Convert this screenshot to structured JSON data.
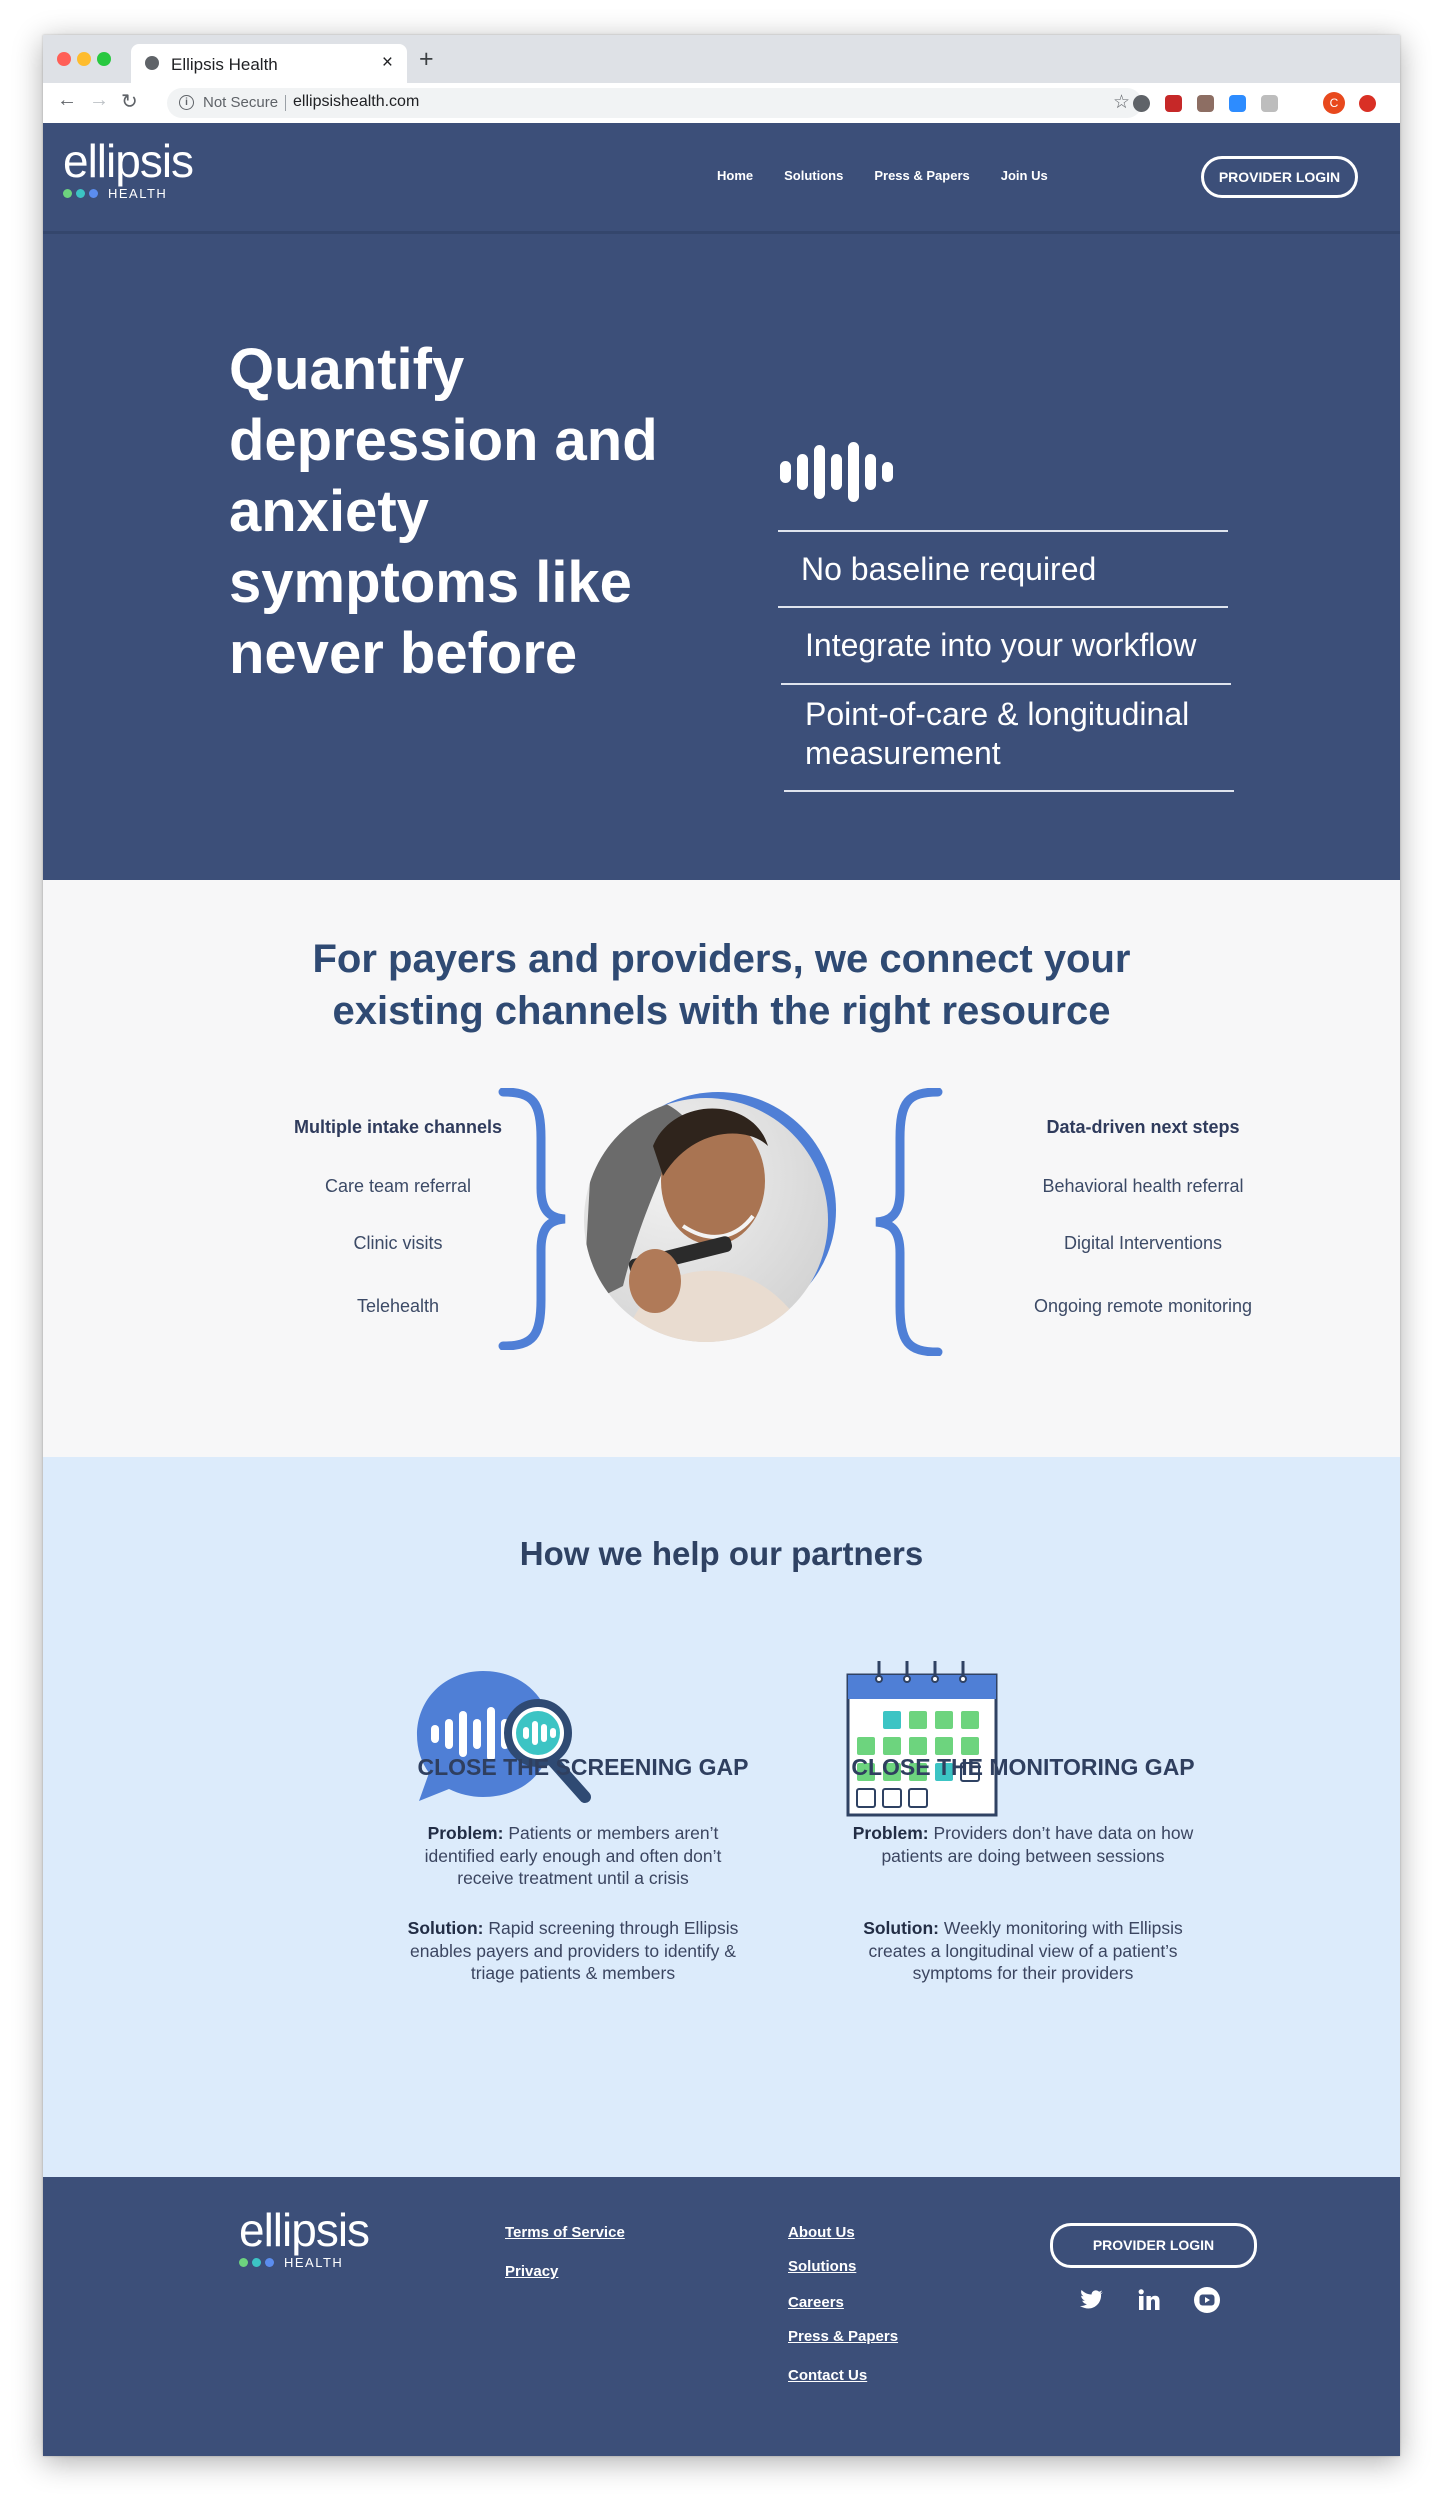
{
  "browser": {
    "tab_title": "Ellipsis Health",
    "tab_close": "×",
    "new_tab": "+",
    "security": "Not Secure",
    "url": "ellipsishealth.com",
    "profile_initial": "C"
  },
  "logo": {
    "word": "ellipsis",
    "sub": "HEALTH",
    "dot_colors": [
      "#6dd47e",
      "#3cc4c4",
      "#5b8def"
    ]
  },
  "nav": {
    "links": [
      "Home",
      "Solutions",
      "Press & Papers",
      "Join Us"
    ],
    "login": "PROVIDER LOGIN"
  },
  "hero": {
    "title": "Quantify depression and anxiety symptoms like never before",
    "features": [
      "No baseline required",
      "Integrate into your workflow",
      "Point-of-care & longitudinal measurement"
    ]
  },
  "connect": {
    "title": "For payers and providers, we connect your existing channels with the right resource",
    "left": {
      "heading": "Multiple intake channels",
      "items": [
        "Care team referral",
        "Clinic visits",
        "Telehealth"
      ]
    },
    "right": {
      "heading": "Data-driven next steps",
      "items": [
        "Behavioral health referral",
        "Digital Interventions",
        "Ongoing remote monitoring"
      ]
    }
  },
  "help": {
    "title": "How we help our partners",
    "cards": [
      {
        "title": "CLOSE THE SCREENING GAP",
        "problem_label": "Problem:",
        "problem": "Patients or members aren’t identified early enough and often don’t receive treatment until a crisis",
        "solution_label": "Solution:",
        "solution": "Rapid screening through Ellipsis enables payers and providers to identify & triage patients & members"
      },
      {
        "title": "CLOSE THE MONITORING GAP",
        "problem_label": "Problem:",
        "problem": "Providers don’t have data on how patients are doing between sessions",
        "solution_label": "Solution:",
        "solution": "Weekly monitoring with Ellipsis creates a longitudinal view of a patient’s symptoms for their providers"
      }
    ]
  },
  "footer": {
    "legal": [
      "Terms of Service",
      "Privacy"
    ],
    "company": [
      "About Us",
      "Solutions",
      "Careers",
      "Press & Papers",
      "Contact Us"
    ],
    "login": "PROVIDER LOGIN",
    "social": [
      "twitter-icon",
      "linkedin-icon",
      "youtube-icon"
    ]
  },
  "colors": {
    "navy": "#3c4f79",
    "accent_blue": "#4f7fd6",
    "light_blue_bg": "#dcebfb",
    "green": "#6dd47e",
    "teal": "#3cc4c4"
  }
}
